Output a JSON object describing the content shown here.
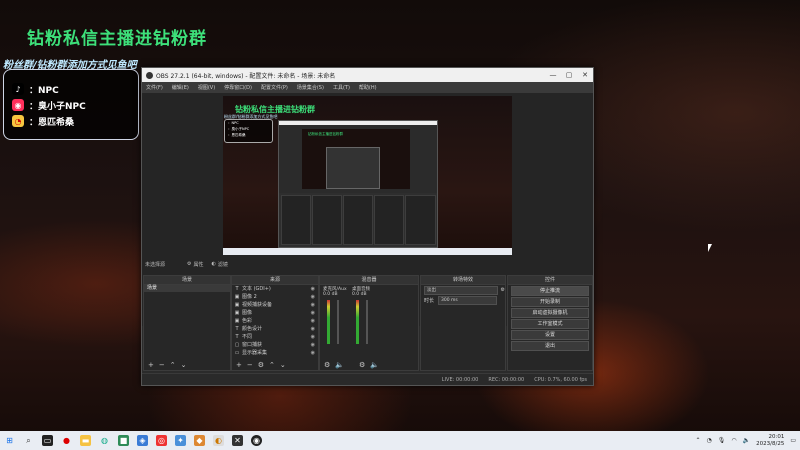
{
  "overlay": {
    "title": "钻粉私信主播进钻粉群",
    "subtitle": "粉丝群/钻粉群添加方式见鱼吧",
    "contacts": [
      {
        "platform_icon": "tiktok-icon",
        "label": "：NPC"
      },
      {
        "platform_icon": "xiaohongshu-icon",
        "label": "：臭小子NPC"
      },
      {
        "platform_icon": "weibo-icon",
        "label": "：恩匹希桑"
      }
    ]
  },
  "obs": {
    "title": "OBS 27.2.1 (64-bit, windows) - 配置文件: 未命名 - 场景: 未命名",
    "window_controls": [
      "—",
      "▢",
      "✕"
    ],
    "menu": [
      "文件(F)",
      "编辑(E)",
      "视图(V)",
      "停靠窗口(D)",
      "配置文件(P)",
      "场景集合(S)",
      "工具(T)",
      "帮助(H)"
    ],
    "preview": {
      "title": "钻粉私信主播进钻粉群"
    },
    "controls_bar": {
      "no_source": "未选择源",
      "properties": "属性",
      "filters": "滤镜"
    },
    "docks": {
      "scenes": {
        "header": "场景",
        "items": [
          "场景"
        ]
      },
      "sources": {
        "header": "来源",
        "items": [
          {
            "icon": "T",
            "name": "文本 (GDI+)"
          },
          {
            "icon": "▣",
            "name": "图像 2"
          },
          {
            "icon": "▣",
            "name": "视频捕获设备"
          },
          {
            "icon": "▣",
            "name": "图像"
          },
          {
            "icon": "▣",
            "name": "色彩"
          },
          {
            "icon": "T",
            "name": "颜色设计"
          },
          {
            "icon": "T",
            "name": "不同"
          },
          {
            "icon": "▢",
            "name": "窗口捕获"
          },
          {
            "icon": "▭",
            "name": "显示器采集"
          }
        ]
      },
      "mixer": {
        "header": "混音器",
        "channels": [
          {
            "name": "麦克风/Aux",
            "value": "0.0 dB"
          },
          {
            "name": "桌面音频",
            "value": "0.0 dB"
          }
        ]
      },
      "transitions": {
        "header": "转场特效",
        "type": "淡出",
        "duration_label": "时长",
        "duration_value": "300 ms"
      },
      "controls": {
        "header": "控件",
        "buttons": [
          "停止推流",
          "开始录制",
          "启动虚拟摄像机",
          "工作室模式",
          "设置",
          "退出"
        ]
      }
    },
    "status": {
      "live": "LIVE: 00:00:00",
      "rec": "REC: 00:00:00",
      "cpu": "CPU: 0.7%, 60.00 fps"
    }
  },
  "taskbar": {
    "time": "20:01",
    "date": "2023/8/25"
  }
}
